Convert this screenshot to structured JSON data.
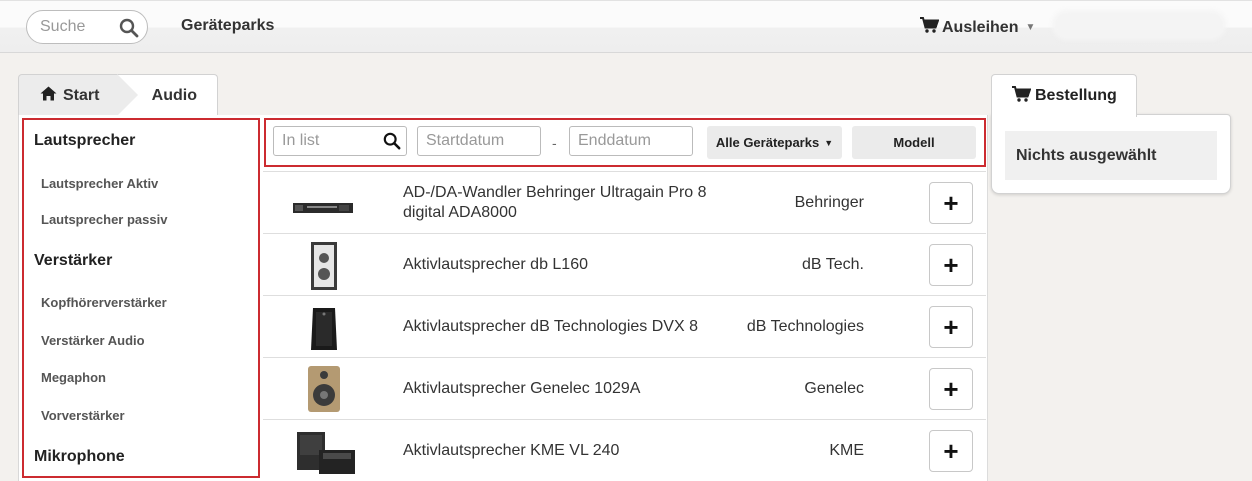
{
  "navbar": {
    "search_placeholder": "Suche",
    "brand": "Geräteparks",
    "cart_label": "Ausleihen",
    "icons": [
      "search-icon",
      "cart-icon",
      "caret-down-icon"
    ]
  },
  "breadcrumb": {
    "start": "Start",
    "current": "Audio"
  },
  "categories": [
    {
      "label": "Lautsprecher",
      "level": "head"
    },
    {
      "label": "Lautsprecher Aktiv",
      "level": "sub"
    },
    {
      "label": "Lautsprecher passiv",
      "level": "sub"
    },
    {
      "label": "Verstärker",
      "level": "head"
    },
    {
      "label": "Kopfhörerverstärker",
      "level": "sub"
    },
    {
      "label": "Verstärker Audio",
      "level": "sub"
    },
    {
      "label": "Megaphon",
      "level": "sub"
    },
    {
      "label": "Vorverstärker",
      "level": "sub"
    },
    {
      "label": "Mikrophone",
      "level": "head"
    }
  ],
  "filters": {
    "list_placeholder": "In list",
    "start_placeholder": "Startdatum",
    "separator": "-",
    "end_placeholder": "Enddatum",
    "park_select": "Alle Geräteparks",
    "model_button": "Modell"
  },
  "items": [
    {
      "name": "AD-/DA-Wandler Behringer Ultragain Pro 8 digital ADA8000",
      "brand": "Behringer",
      "add": "+",
      "thumb": "rack-unit"
    },
    {
      "name": "Aktivlautsprecher db L160",
      "brand": "dB Tech.",
      "add": "+",
      "thumb": "speaker-small"
    },
    {
      "name": "Aktivlautsprecher dB Technologies DVX 8",
      "brand": "dB Technologies",
      "add": "+",
      "thumb": "speaker-black"
    },
    {
      "name": "Aktivlautsprecher Genelec 1029A",
      "brand": "Genelec",
      "add": "+",
      "thumb": "studio-monitor"
    },
    {
      "name": "Aktivlautsprecher KME VL 240",
      "brand": "KME",
      "add": "+",
      "thumb": "speaker-set"
    }
  ],
  "order": {
    "tab_label": "Bestellung",
    "empty_text": "Nichts ausgewählt"
  },
  "colors": {
    "highlight_border": "#cc2b30",
    "page_background": "#f3f1ee"
  }
}
